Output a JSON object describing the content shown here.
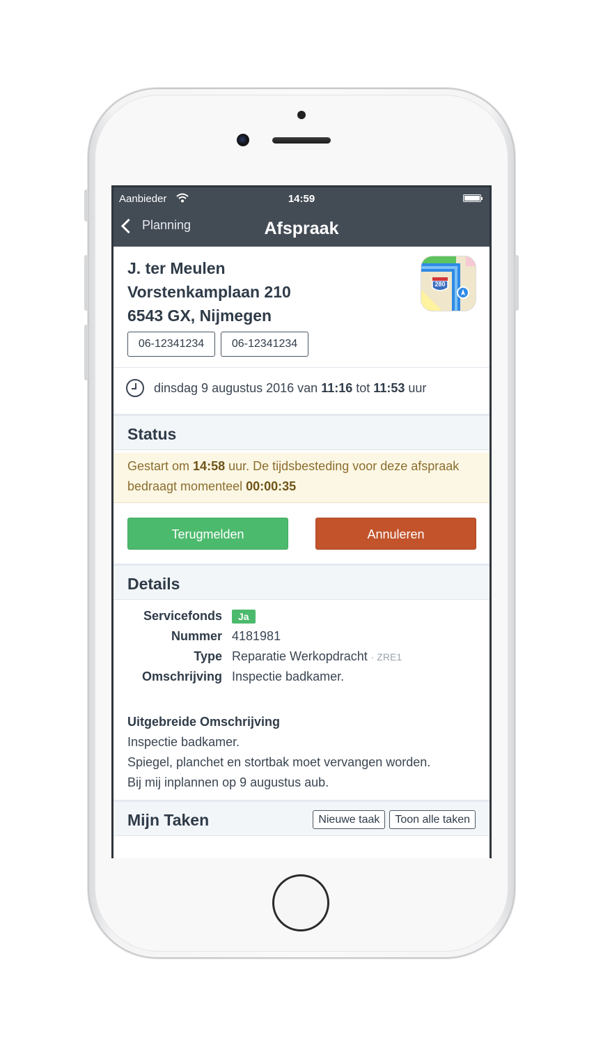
{
  "status_bar": {
    "carrier": "Aanbieder",
    "time": "14:59"
  },
  "nav": {
    "back_label": "Planning",
    "title": "Afspraak"
  },
  "address": {
    "name": "J. ter Meulen",
    "street": "Vorstenkamplaan 210",
    "city": "6543 GX, Nijmegen",
    "phones": [
      "06-12341234",
      "06-12341234"
    ],
    "maps_route_number": "280"
  },
  "appointment": {
    "prefix": "dinsdag 9 augustus 2016 van",
    "start": "11:16",
    "mid": "tot",
    "end": "11:53",
    "suffix": "uur"
  },
  "status": {
    "title": "Status",
    "text_1": "Gestart om",
    "started_at": "14:58",
    "text_2": "uur. De tijdsbesteding voor deze afspraak bedraagt momenteel",
    "elapsed": "00:00:35",
    "btn_report": "Terugmelden",
    "btn_cancel": "Annuleren"
  },
  "details": {
    "title": "Details",
    "rows": [
      {
        "label": "Servicefonds",
        "value": "Ja"
      },
      {
        "label": "Nummer",
        "value": "4181981"
      },
      {
        "label": "Type",
        "value": "Reparatie Werkopdracht",
        "sub": "· ZRE1"
      },
      {
        "label": "Omschrijving",
        "value": "Inspectie badkamer."
      }
    ],
    "ext_title": "Uitgebreide Omschrijving",
    "ext_lines": [
      "Inspectie badkamer.",
      "Spiegel, planchet en stortbak moet vervangen worden.",
      "Bij mij inplannen op 9 augustus aub."
    ]
  },
  "tasks": {
    "title": "Mijn Taken",
    "btn_new": "Nieuwe taak",
    "btn_all": "Toon alle taken"
  },
  "colors": {
    "navbar": "#434b55",
    "success": "#4cba6c",
    "danger": "#c2532b",
    "alert_bg": "#fcf7e4"
  }
}
